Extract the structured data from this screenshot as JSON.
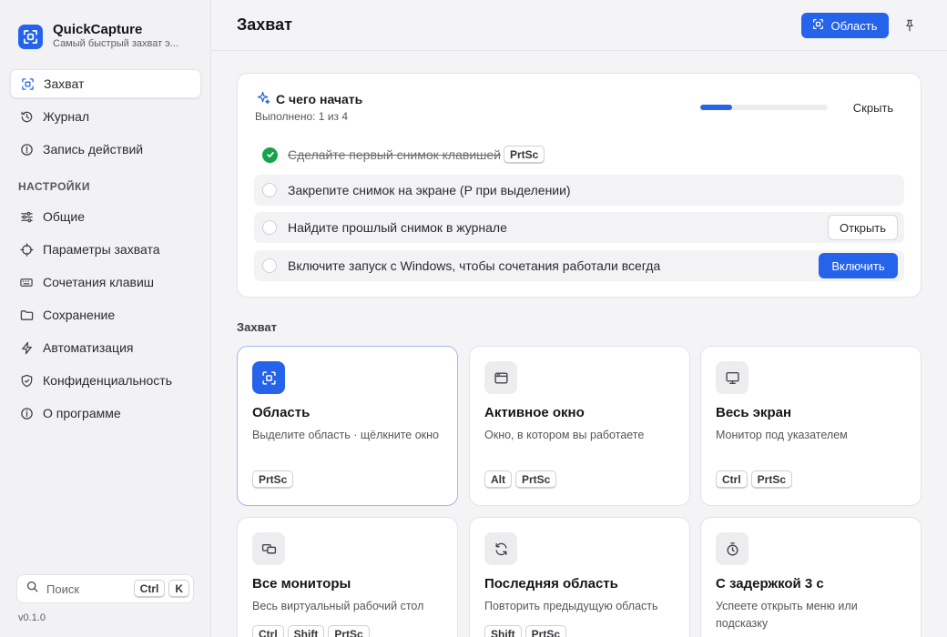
{
  "app": {
    "name": "QuickCapture",
    "subtitle": "Самый быстрый захват э...",
    "version": "v0.1.0"
  },
  "nav": {
    "items": [
      {
        "label": "Захват",
        "icon": "capture-icon",
        "active": true
      },
      {
        "label": "Журнал",
        "icon": "history-icon"
      },
      {
        "label": "Запись действий",
        "icon": "record-icon"
      }
    ],
    "settings_heading": "НАСТРОЙКИ",
    "settings_items": [
      {
        "label": "Общие",
        "icon": "sliders-icon"
      },
      {
        "label": "Параметры захвата",
        "icon": "crosshair-icon"
      },
      {
        "label": "Сочетания клавиш",
        "icon": "keyboard-icon"
      },
      {
        "label": "Сохранение",
        "icon": "folder-icon"
      },
      {
        "label": "Автоматизация",
        "icon": "bolt-icon"
      },
      {
        "label": "Конфиденциальность",
        "icon": "shield-icon"
      },
      {
        "label": "О программе",
        "icon": "info-icon"
      }
    ]
  },
  "search": {
    "placeholder": "Поиск",
    "keys": [
      "Ctrl",
      "K"
    ]
  },
  "header": {
    "title": "Захват",
    "area_button": "Область"
  },
  "onboarding": {
    "title": "С чего начать",
    "subtitle": "Выполнено: 1 из 4",
    "progress": 0.25,
    "hide_label": "Скрыть",
    "tasks": [
      {
        "text": "Сделайте первый снимок клавишей",
        "key": "PrtSc",
        "done": true
      },
      {
        "text": "Закрепите снимок на экране (P при выделении)",
        "done": false
      },
      {
        "text": "Найдите прошлый снимок в журнале",
        "done": false,
        "button": "Открыть"
      },
      {
        "text": "Включите запуск с Windows, чтобы сочетания работали всегда",
        "done": false,
        "button": "Включить"
      }
    ]
  },
  "capture": {
    "section_label": "Захват",
    "cards": [
      {
        "title": "Область",
        "desc": "Выделите область · щёлкните окно",
        "keys": [
          "PrtSc"
        ],
        "icon": "region-icon"
      },
      {
        "title": "Активное окно",
        "desc": "Окно, в котором вы работаете",
        "keys": [
          "Alt",
          "PrtSc"
        ],
        "icon": "window-icon"
      },
      {
        "title": "Весь экран",
        "desc": "Монитор под указателем",
        "keys": [
          "Ctrl",
          "PrtSc"
        ],
        "icon": "monitor-icon"
      },
      {
        "title": "Все мониторы",
        "desc": "Весь виртуальный рабочий стол",
        "keys": [
          "Ctrl",
          "Shift",
          "PrtSc"
        ],
        "icon": "monitors-icon"
      },
      {
        "title": "Последняя область",
        "desc": "Повторить предыдущую область",
        "keys": [
          "Shift",
          "PrtSc"
        ],
        "icon": "repeat-icon"
      },
      {
        "title": "С задержкой 3 с",
        "desc": "Успеете открыть меню или подсказку",
        "keys": [],
        "icon": "timer-icon"
      }
    ]
  },
  "colors": {
    "accent": "#2563eb",
    "success": "#16a34a"
  }
}
